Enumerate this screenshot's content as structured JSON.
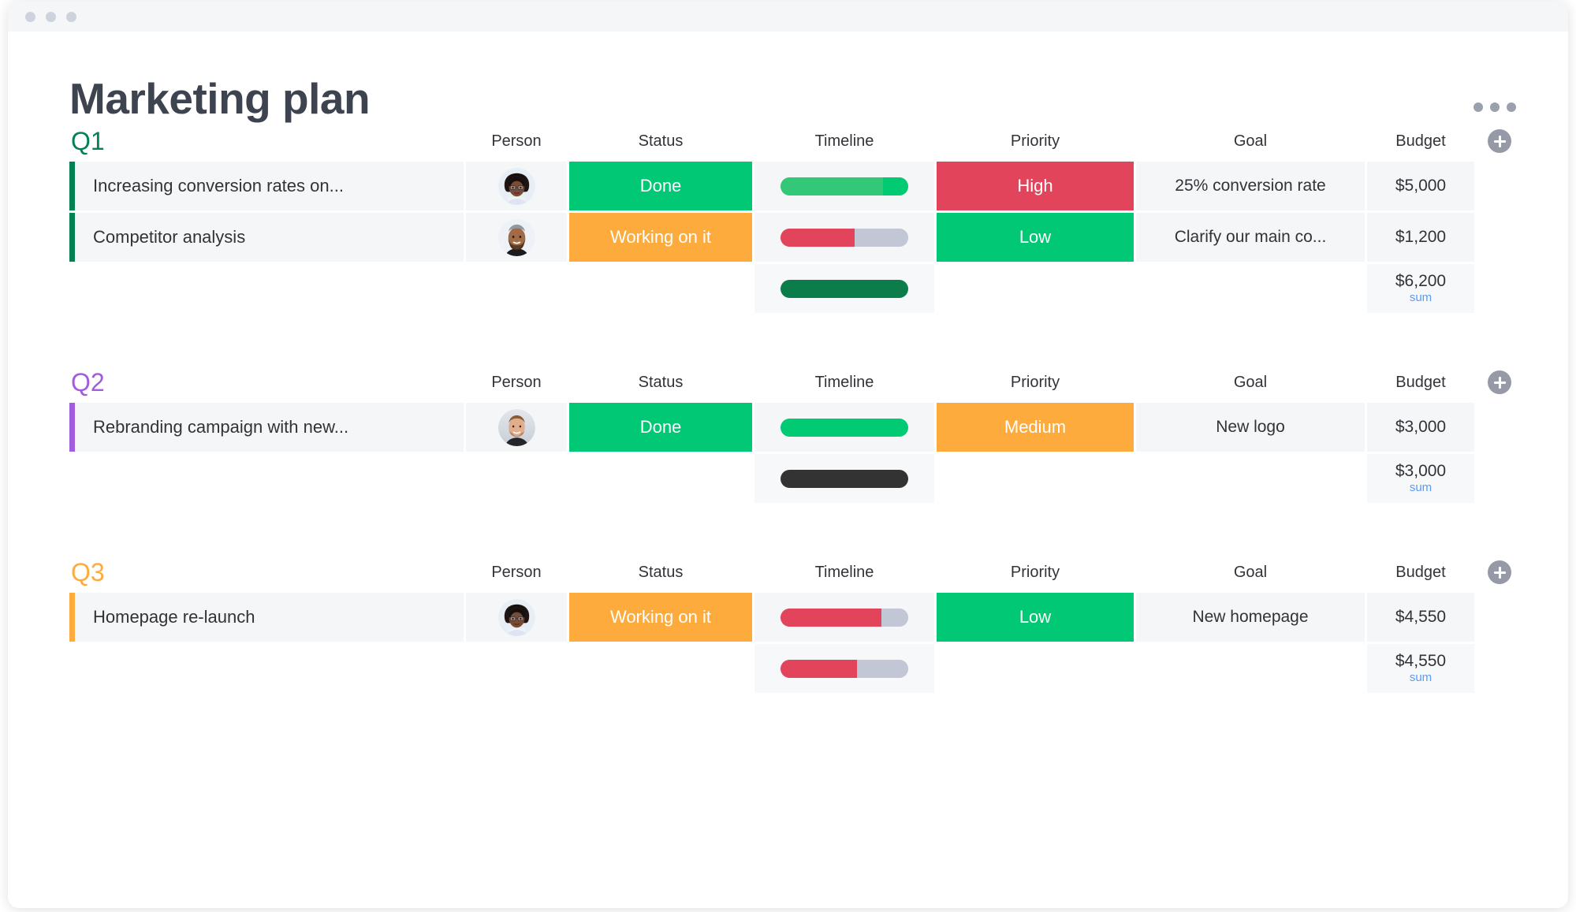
{
  "window": {
    "dots": [
      "red-dot",
      "yellow-dot",
      "green-dot"
    ],
    "title_bar_color": "#f4f6f8"
  },
  "header": {
    "title": "Marketing plan",
    "more_menu_label": "…"
  },
  "colors": {
    "done_green": "#00c875",
    "working_orange": "#fdab3d",
    "high_red": "#e2445c",
    "low_green": "#00c875",
    "medium_orange": "#fdab3d",
    "q1_accent": "#038153",
    "q2_accent": "#a25ddc",
    "q3_accent": "#fdab3d",
    "sum_link": "#579bfc",
    "timeline_track": "#c3c6d4"
  },
  "columns": [
    "Person",
    "Status",
    "Timeline",
    "Priority",
    "Goal",
    "Budget"
  ],
  "groups": [
    {
      "title": "Q1",
      "accent": "#038153",
      "add_column_label": "+",
      "items": [
        {
          "name": "Increasing conversion rates on...",
          "person": "avatar-woman-glasses",
          "status": "Done",
          "status_color": "#00c875",
          "timeline": {
            "segments": [
              {
                "color": "#33c878",
                "pct": 80
              },
              {
                "color": "#00ca72",
                "pct": 20
              }
            ]
          },
          "priority": "High",
          "priority_color": "#e2445c",
          "goal": "25% conversion rate",
          "budget": "$5,000"
        },
        {
          "name": "Competitor analysis",
          "person": "avatar-man-beard",
          "status": "Working on it",
          "status_color": "#fdab3d",
          "timeline": {
            "segments": [
              {
                "color": "#e2445c",
                "pct": 58
              },
              {
                "color": "#c3c6d4",
                "pct": 42
              }
            ]
          },
          "priority": "Low",
          "priority_color": "#00c875",
          "goal": "Clarify our main co...",
          "budget": "$1,200"
        }
      ],
      "summary": {
        "timeline": {
          "segments": [
            {
              "color": "#0b7d4a",
              "pct": 100
            }
          ]
        },
        "budget_value": "$6,200",
        "budget_label": "sum"
      }
    },
    {
      "title": "Q2",
      "accent": "#a25ddc",
      "add_column_label": "+",
      "items": [
        {
          "name": "Rebranding campaign with new...",
          "person": "avatar-man-smiling",
          "status": "Done",
          "status_color": "#00c875",
          "timeline": {
            "segments": [
              {
                "color": "#00ca72",
                "pct": 100
              }
            ]
          },
          "priority": "Medium",
          "priority_color": "#fdab3d",
          "goal": "New logo",
          "budget": "$3,000"
        }
      ],
      "summary": {
        "timeline": {
          "segments": [
            {
              "color": "#333333",
              "pct": 100
            }
          ]
        },
        "budget_value": "$3,000",
        "budget_label": "sum"
      }
    },
    {
      "title": "Q3",
      "accent": "#fdab3d",
      "add_column_label": "+",
      "items": [
        {
          "name": "Homepage re-launch",
          "person": "avatar-woman-glasses",
          "status": "Working on it",
          "status_color": "#fdab3d",
          "timeline": {
            "segments": [
              {
                "color": "#e2445c",
                "pct": 79
              },
              {
                "color": "#c3c6d4",
                "pct": 21
              }
            ]
          },
          "priority": "Low",
          "priority_color": "#00c875",
          "goal": "New homepage",
          "budget": "$4,550"
        }
      ],
      "summary": {
        "timeline": {
          "segments": [
            {
              "color": "#e2445c",
              "pct": 60
            },
            {
              "color": "#c3c6d4",
              "pct": 40
            }
          ]
        },
        "budget_value": "$4,550",
        "budget_label": "sum"
      }
    }
  ]
}
